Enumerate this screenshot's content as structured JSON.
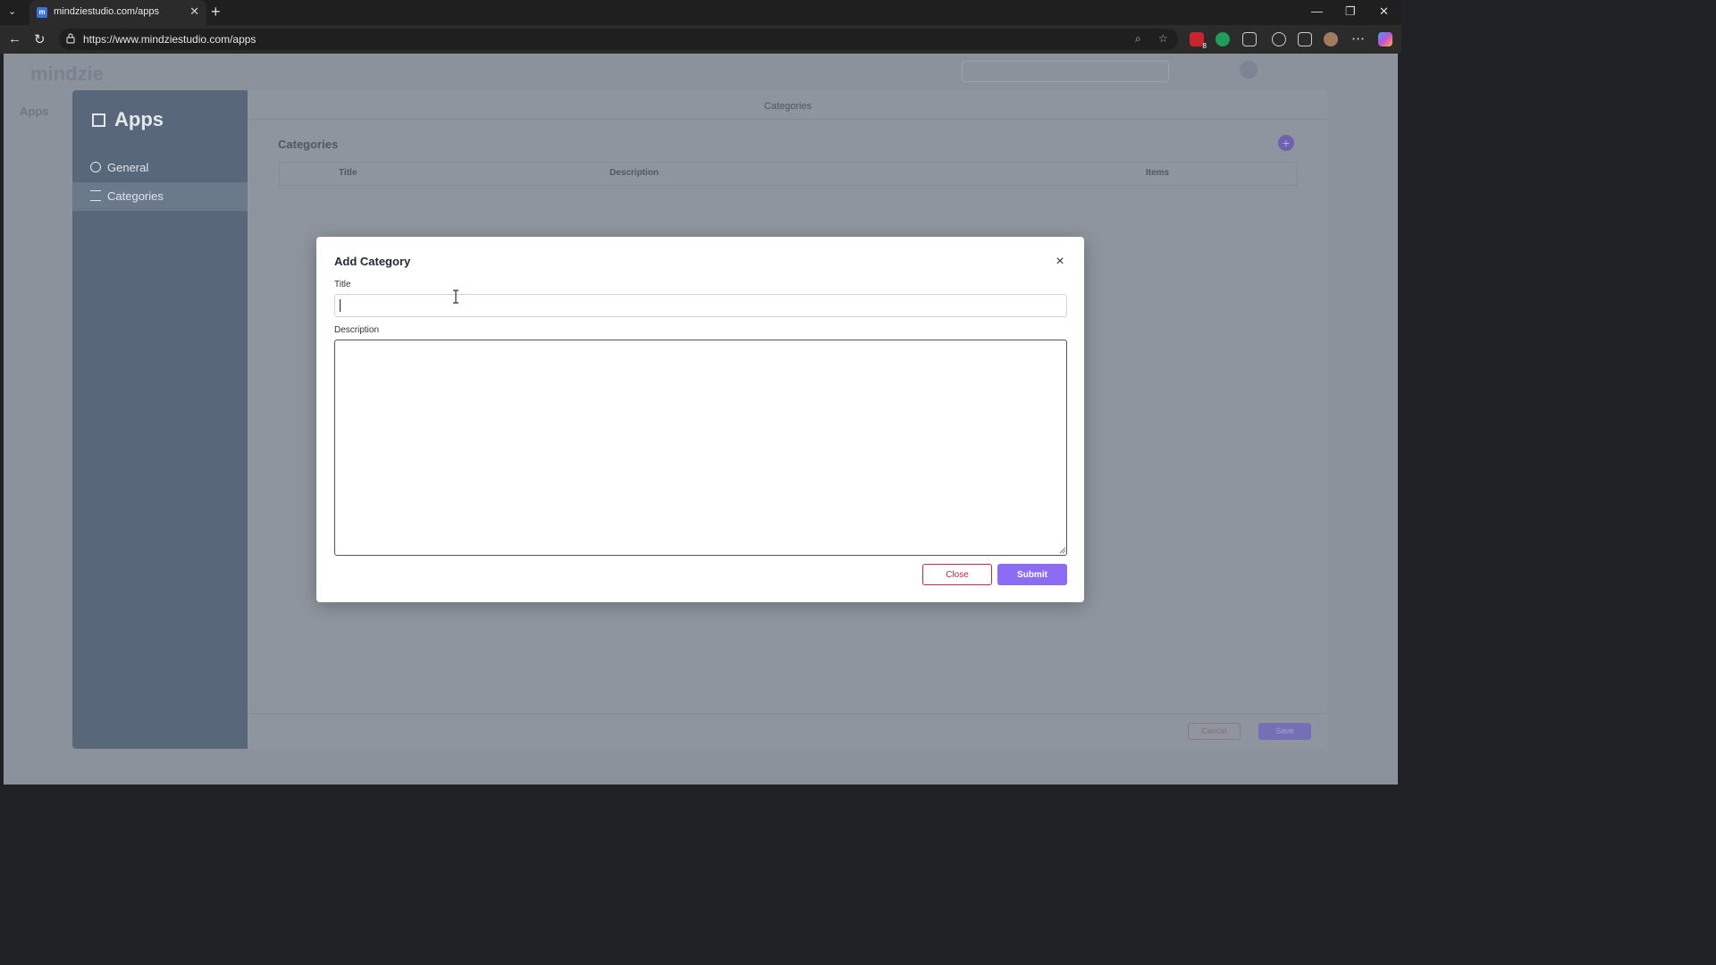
{
  "browser": {
    "tab_title": "mindziestudio.com/apps",
    "favicon_letter": "m",
    "url": "https://www.mindziestudio.com/apps",
    "extension_badge": "8"
  },
  "app": {
    "logo": "mindzie",
    "breadcrumb": "Apps"
  },
  "sidebar": {
    "heading": "Apps",
    "items": [
      {
        "label": "General"
      },
      {
        "label": "Categories"
      }
    ]
  },
  "main": {
    "page_title": "Categories",
    "section_title": "Categories",
    "add_symbol": "+",
    "columns": [
      "Title",
      "Description",
      "Items"
    ],
    "footer": {
      "cancel_label": "Cancel",
      "save_label": "Save"
    }
  },
  "modal": {
    "title": "Add Category",
    "close_symbol": "×",
    "title_label": "Title",
    "title_value": "",
    "description_label": "Description",
    "description_value": "",
    "close_label": "Close",
    "submit_label": "Submit"
  },
  "colors": {
    "accent": "#8b6cf3",
    "danger": "#c0284b",
    "sidebar": "#58687a"
  }
}
